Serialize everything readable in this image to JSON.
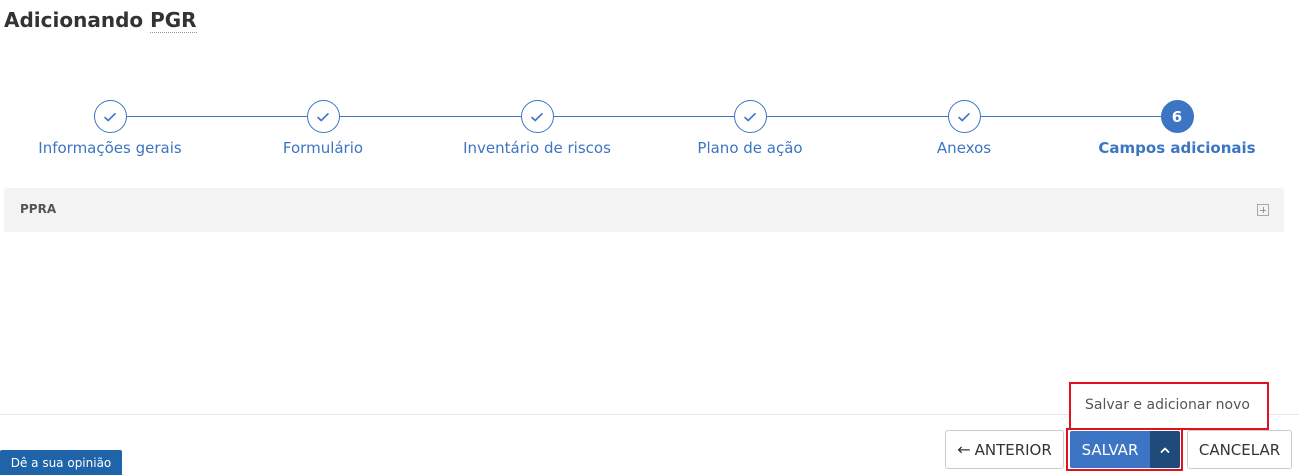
{
  "page": {
    "title_prefix": "Adicionando",
    "title_entity": "PGR"
  },
  "stepper": {
    "steps": [
      {
        "label": "Informações gerais",
        "status": "done"
      },
      {
        "label": "Formulário",
        "status": "done"
      },
      {
        "label": "Inventário de riscos",
        "status": "done"
      },
      {
        "label": "Plano de ação",
        "status": "done"
      },
      {
        "label": "Anexos",
        "status": "done"
      },
      {
        "label": "Campos adicionais",
        "status": "active",
        "number": "6"
      }
    ]
  },
  "panel": {
    "title": "PPRA",
    "expand_icon": "plus-square-icon"
  },
  "dropup": {
    "item": "Salvar e adicionar novo"
  },
  "footer": {
    "anterior_label": "ANTERIOR",
    "anterior_icon": "arrow-left-icon",
    "save_label": "SALVAR",
    "caret_icon": "chevron-up-icon",
    "cancel_label": "CANCELAR"
  },
  "feedback": {
    "label": "Dê a sua opinião"
  },
  "colors": {
    "accent": "#3b75c4",
    "accent_dark": "#1f4a7a",
    "highlight": "#e0121f",
    "feedback_bg": "#1f64a8"
  }
}
